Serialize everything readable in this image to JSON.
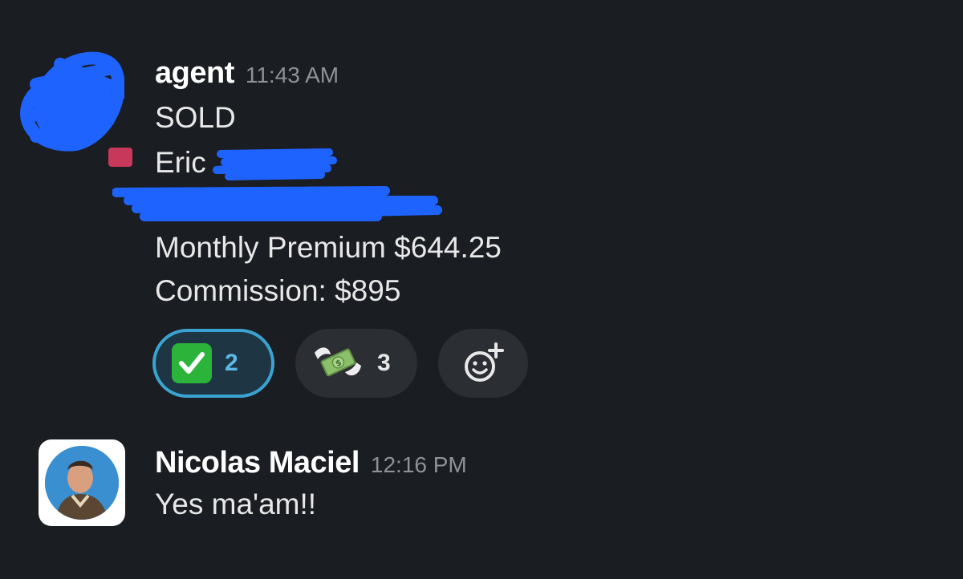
{
  "messages": [
    {
      "sender": "agent",
      "time": "11:43 AM",
      "lines": {
        "status": "SOLD",
        "client": "Eric",
        "premium": "Monthly Premium $644.25",
        "commission": "Commission: $895"
      },
      "reactions": [
        {
          "emoji": "white-check-mark",
          "count": "2",
          "active": true
        },
        {
          "emoji": "money-with-wings",
          "count": "3",
          "active": false
        },
        {
          "emoji": "add-reaction",
          "count": "",
          "active": false
        }
      ]
    },
    {
      "sender": "Nicolas Maciel",
      "time": "12:16 PM",
      "text": "Yes ma'am!!"
    }
  ],
  "colors": {
    "background": "#1a1d21",
    "scribble": "#1f63ff",
    "active_reaction_border": "#3aa3d1",
    "check_green": "#2bb33a"
  }
}
